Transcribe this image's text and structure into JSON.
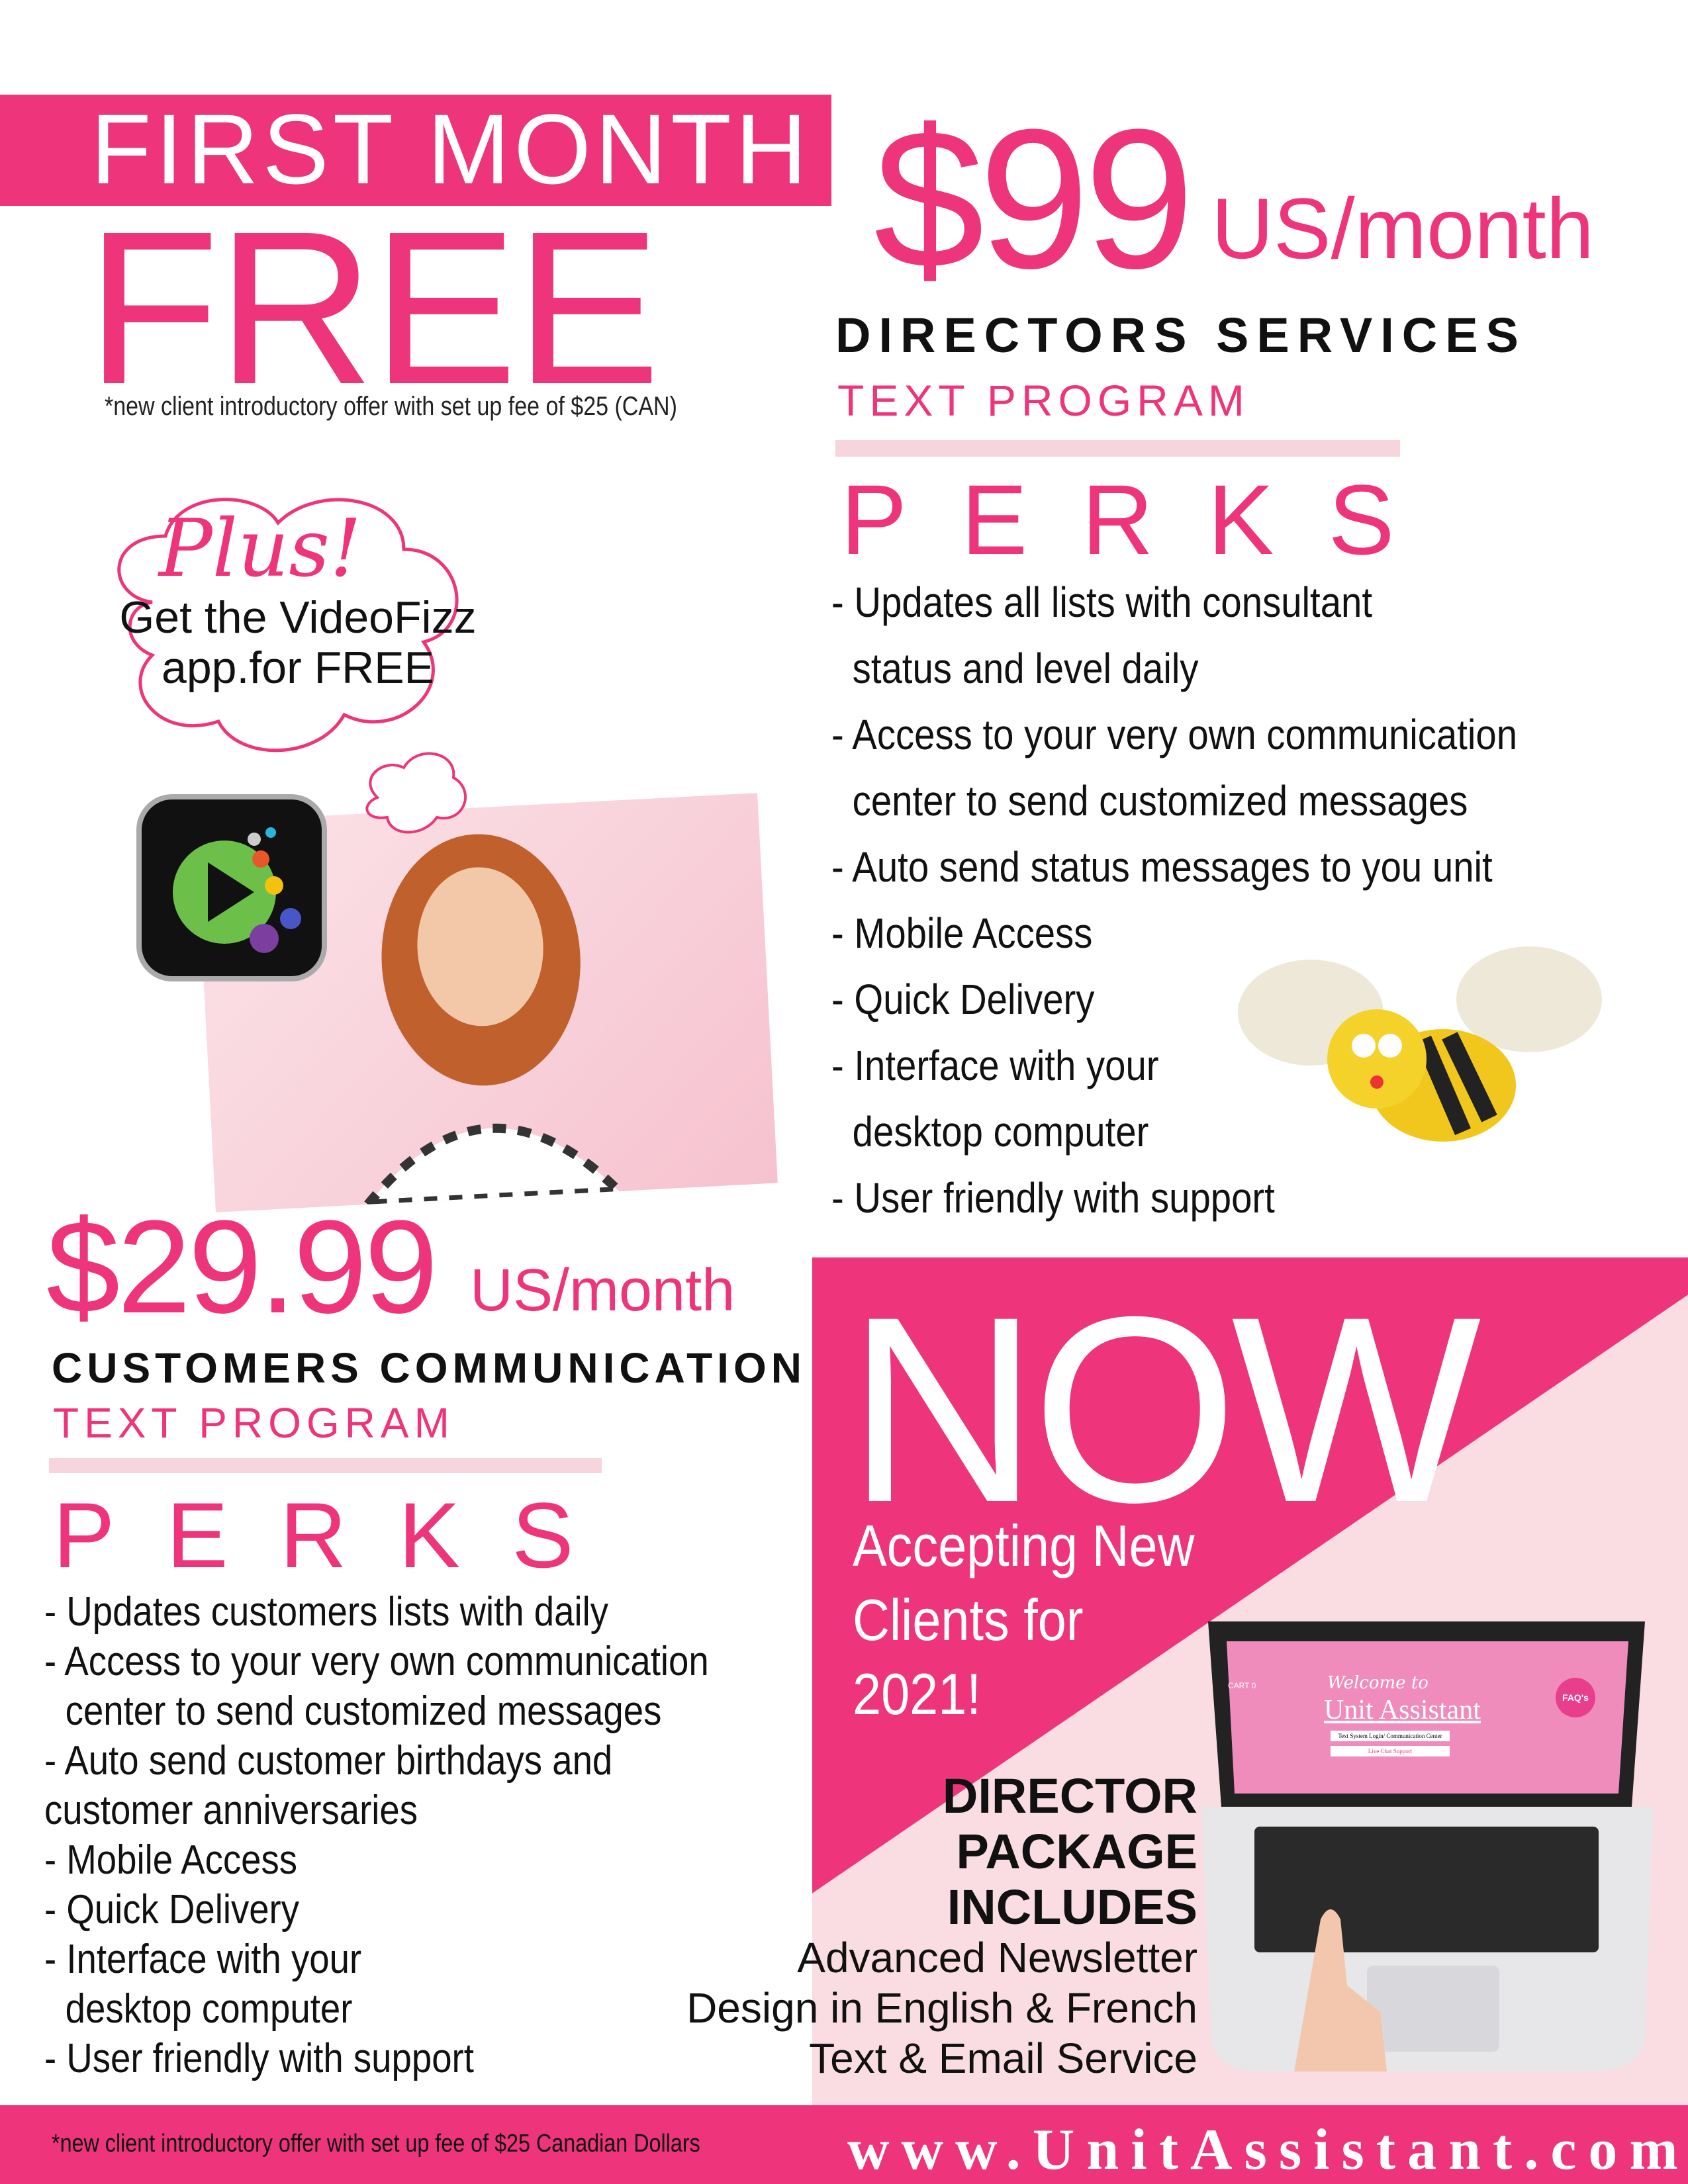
{
  "colors": {
    "brand_pink": "#ee347a",
    "light_pink": "#f9dde2",
    "rule_pink": "#f7d5dc"
  },
  "offer": {
    "first_month": "FIRST MONTH",
    "free": "FREE",
    "note": "*new client introductory offer with set up fee of $25 (CAN)"
  },
  "directors": {
    "price": "$99",
    "unit": "US/month",
    "title": "DIRECTORS SERVICES",
    "subtitle": "TEXT PROGRAM",
    "perks_heading": "PERKS",
    "perks": [
      "- Updates all lists with consultant",
      "   status and level daily",
      "- Access to your very own communication",
      "   center to send customized messages",
      "- Auto send status messages to you unit",
      "- Mobile Access",
      "- Quick Delivery",
      "- Interface with your",
      "   desktop computer",
      "- User friendly with support"
    ]
  },
  "promo": {
    "plus": "Plus!",
    "line1": "Get the VideoFizz",
    "line2": "app.for FREE",
    "icon": "videofizz-app-icon"
  },
  "customers": {
    "price": "$29.99",
    "unit": "US/month",
    "title": "CUSTOMERS COMMUNICATION",
    "subtitle": "TEXT PROGRAM",
    "perks_heading": "PERKS",
    "perks": [
      "- Updates customers lists with daily",
      "- Access to your very own communication",
      "   center to send customized messages",
      "- Auto send customer birthdays and",
      "customer anniversaries",
      "- Mobile Access",
      "- Quick Delivery",
      "- Interface with your",
      "   desktop computer",
      "- User friendly with support"
    ]
  },
  "now": {
    "headline": "NOW",
    "line1": "Accepting New",
    "line2": "Clients for",
    "line3": "2021!"
  },
  "package": {
    "h1": "DIRECTOR",
    "h2": "PACKAGE",
    "h3": "INCLUDES",
    "items": [
      "Advanced Newsletter",
      "Design in English & French",
      "Text & Email Service"
    ]
  },
  "laptop_screen": {
    "cart": "CART 0",
    "welcome": "Welcome to",
    "brand": "Unit Assistant",
    "login": "Text System Login/ Communication Center",
    "chat": "Live Chat Support",
    "faq": "FAQ's"
  },
  "footer": {
    "note": "*new client introductory offer with set up fee of  $25 Canadian Dollars",
    "url": "www.UnitAssistant.com"
  }
}
